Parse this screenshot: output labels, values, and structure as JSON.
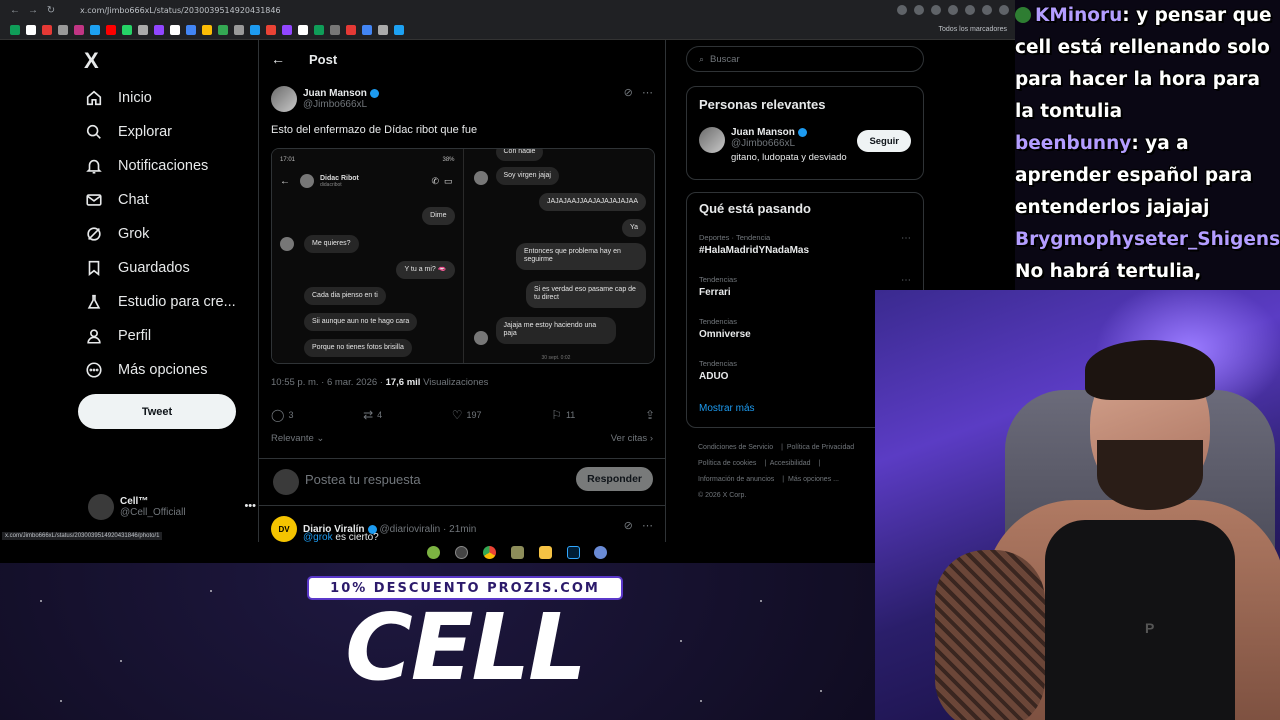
{
  "browser": {
    "url": "x.com/Jimbo666xL/status/2030039514920431846",
    "bookmarks_label": "Todos los marcadores",
    "status_url": "x.com/Jimbo666xL/status/2030039514920431846/photo/1"
  },
  "nav": {
    "logo": "X",
    "items": [
      "Inicio",
      "Explorar",
      "Notificaciones",
      "Chat",
      "Grok",
      "Guardados",
      "Estudio para cre...",
      "Perfil",
      "Más opciones"
    ],
    "tweet_button": "Tweet",
    "profile_name": "Cell™",
    "profile_handle": "@Cell_Officiall"
  },
  "post": {
    "header_title": "Post",
    "author_name": "Juan Manson",
    "author_handle": "@Jimbo666xL",
    "text": "Esto del enfermazo de Dídac ribot que fue",
    "screenshot_left": {
      "status_time": "17:01",
      "status_right": "38%",
      "contact_name": "Didac Ribot",
      "contact_handle": "didacribot",
      "messages": [
        "Dime",
        "Me quieres?",
        "Y tu a mi? 🫦",
        "Cada dia pienso en ti",
        "Sii aunque aun no te hago cara",
        "Porque no tienes fotos brisilla"
      ]
    },
    "screenshot_right": {
      "messages": [
        "Con nadie",
        "Soy virgen jajaj",
        "JAJAJAAJJAAJAJAJAJAJAA",
        "Ya",
        "Entonces que problema hay en seguirme",
        "Si es verdad eso pasame cap de tu direct",
        "Jajaja me estoy haciendo una paja"
      ],
      "timestamp": "30 sept. 0:02"
    },
    "meta_time": "10:55 p. m. · 6 mar. 2026 ·",
    "meta_views": "17,6 mil",
    "meta_views_label": "Visualizaciones",
    "stats": {
      "replies": "3",
      "retweets": "4",
      "likes": "197",
      "bookmarks": "11"
    },
    "sort_label": "Relevante",
    "quotes_label": "Ver citas",
    "reply_placeholder": "Postea tu respuesta",
    "reply_button": "Responder",
    "next_name": "Diario Viralín",
    "next_handle": "@diarioviralin · 21min",
    "next_text_link": "@grok",
    "next_text": " es cierto?"
  },
  "right": {
    "search_placeholder": "Buscar",
    "relevant_title": "Personas relevantes",
    "relevant_name": "Juan Manson",
    "relevant_handle": "@Jimbo666xL",
    "relevant_bio": "gitano, ludopata y desviado",
    "follow_button": "Seguir",
    "trends_title": "Qué está pasando",
    "trends": [
      {
        "category": "Deportes · Tendencia",
        "name": "#HalaMadridYNadaMas"
      },
      {
        "category": "Tendencias",
        "name": "Ferrari"
      },
      {
        "category": "Tendencias",
        "name": "Omniverse"
      },
      {
        "category": "Tendencias",
        "name": "ADUO"
      }
    ],
    "show_more": "Mostrar más",
    "footer": [
      "Condiciones de Servicio",
      "Política de Privacidad",
      "Política de cookies",
      "Accesibilidad",
      "Información de anuncios",
      "Más opciones ...",
      "© 2026 X Corp."
    ]
  },
  "chat": [
    {
      "user": "KMinoru",
      "text": ": y pensar que cell está rellenando solo para hacer la hora para la tontulia"
    },
    {
      "user": "beenbunny",
      "text": ": ya a aprender español para entenderlos jajajaj"
    },
    {
      "user": "Brygmophyseter_Shigensis",
      "text": ": No habrá tertulia, verdad?"
    }
  ],
  "promo": {
    "line": "10% DESCUENTO PROZIS.COM",
    "brand": "CELL"
  },
  "colors": {
    "accent": "#1d9bf0",
    "background": "#000000",
    "chat_user": "#b39dff"
  }
}
